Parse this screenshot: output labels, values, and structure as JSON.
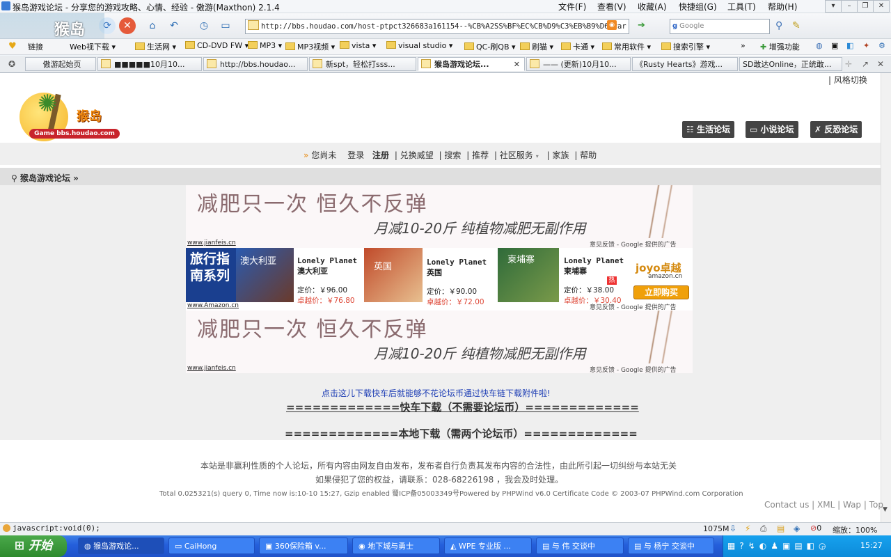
{
  "window": {
    "title": "猴岛游戏论坛 - 分享您的游戏攻略、心情、经验 - 傲游(Maxthon) 2.1.4",
    "menus": [
      "文件(F)",
      "查看(V)",
      "收藏(A)",
      "快捷组(G)",
      "工具(T)",
      "帮助(H)"
    ]
  },
  "toolbar": {
    "address": "http://bbs.houdao.com/host-ptpct326683a161154--%CB%A2SS%BF%EC%CB%D9%C3%EB%B9%D6.rar",
    "search_placeholder": "Google"
  },
  "bookmarks": [
    "链接",
    "Web视下载",
    "生活网",
    "CD-DVD FW",
    "MP3",
    "MP3视频",
    "vista",
    "visual studio",
    "QC-刷QB",
    "刷猫",
    "卡通",
    "常用软件",
    "搜索引擎",
    "增强功能"
  ],
  "tabs": [
    "傲游起始页",
    "■■■■■10月10...",
    "http://bbs.houdao...",
    "新spt，轻松打sss...",
    "猴岛游戏论坛...",
    "—— (更新)10月10...",
    "《Rusty Hearts》游戏...",
    "SD敢达Online，正统敢..."
  ],
  "page": {
    "style_switch": "| 风格切换",
    "logo_text": "猴岛",
    "logo_sub": "Game bbs.houdao.com",
    "forum_buttons": [
      "生活论坛",
      "小说论坛",
      "反恐论坛"
    ],
    "nav": {
      "guest": "您尚未",
      "login": "登录",
      "register": "注册",
      "links": [
        "| 兑换威望",
        "| 搜索",
        "| 推荐",
        "| 社区服务",
        "| 家族",
        "| 帮助"
      ]
    },
    "breadcrumb": "猴岛游戏论坛 »",
    "ad1": {
      "headline": "减肥只一次  恒久不反弹",
      "sub": "月减10-20斤   纯植物减肥无副作用",
      "caption": "www.jianfeis.cn",
      "google": "意见反馈 - Google 提供的广告"
    },
    "ad_amazon": {
      "left": "旅行指南系列",
      "caption": "www.Amazon.cn",
      "google": "意见反馈 - Google 提供的广告",
      "books": [
        {
          "series": "Lonely Planet",
          "name": "澳大利亚",
          "cover": "澳大利亚",
          "list": "定价：￥96.00",
          "price": "卓越价：￥76.80"
        },
        {
          "series": "Lonely Planet",
          "name": "英国",
          "cover": "英国",
          "list": "定价：￥90.00",
          "price": "卓越价：￥72.00"
        },
        {
          "series": "Lonely Planet",
          "name": "柬埔寨",
          "cover": "柬埔寨",
          "badge": "热",
          "list": "定价：￥38.00",
          "price": "卓越价：￥30.40"
        }
      ],
      "joyo": "joyo卓越",
      "joyo_sub": "amazon.cn",
      "buy": "立即购买"
    },
    "ad2": {
      "headline": "减肥只一次  恒久不反弹",
      "sub": "月减10-20斤   纯植物减肥无副作用",
      "caption": "www.jianfeis.cn",
      "google": "意见反馈 - Google 提供的广告"
    },
    "kuaiche_note": "点击这儿下载快车后就能够不花论坛币通过快车链下载附件啦!",
    "download_fast": "=============快车下载（不需要论坛币）=============",
    "download_local": "=============本地下载（需两个论坛币）=============",
    "footer": {
      "line1": "本站是非赢利性质的个人论坛，所有内容由网友自由发布，发布者自行负责其发布内容的合法性，由此所引起一切纠纷与本站无关",
      "line2": "如果侵犯了您的权益，请联系：028-68226198 ，我会及时处理。",
      "line3": "Total 0.025321(s) query 0, Time now is:10-10 15:27, Gzip enabled 蜀ICP备05003349号Powered by PHPWind v6.0 Certificate Code © 2003-07 PHPWind.com Corporation",
      "links": [
        "Contact us",
        "XML",
        "Wap",
        "Top"
      ]
    }
  },
  "status": {
    "text": "javascript:void(0);",
    "memory": "1075M",
    "count": "0",
    "zoom": "缩放：100%"
  },
  "taskbar": {
    "start": "开始",
    "tasks": [
      "猴岛游戏论...",
      "CaiHong",
      "360保险箱 v...",
      "地下城与勇士",
      "WPE 专业版 ...",
      "与 伟 交谈中",
      "与 杨宁 交谈中"
    ],
    "clock": "15:27"
  }
}
